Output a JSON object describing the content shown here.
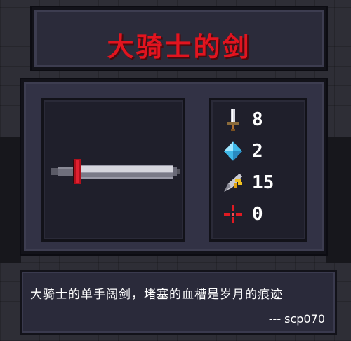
{
  "title": "大骑士的剑",
  "stats": [
    {
      "icon": "sword-damage-icon",
      "value": "8"
    },
    {
      "icon": "energy-crystal-icon",
      "value": "2"
    },
    {
      "icon": "critical-chance-icon",
      "value": "15"
    },
    {
      "icon": "accuracy-crosshair-icon",
      "value": "0"
    }
  ],
  "description": "大骑士的单手阔剑，堵塞的血槽是岁月的痕迹",
  "author": "--- scp070",
  "colors": {
    "title": "#e2141f",
    "panel": "#2b2b3a",
    "inner": "#1f1f2b"
  }
}
